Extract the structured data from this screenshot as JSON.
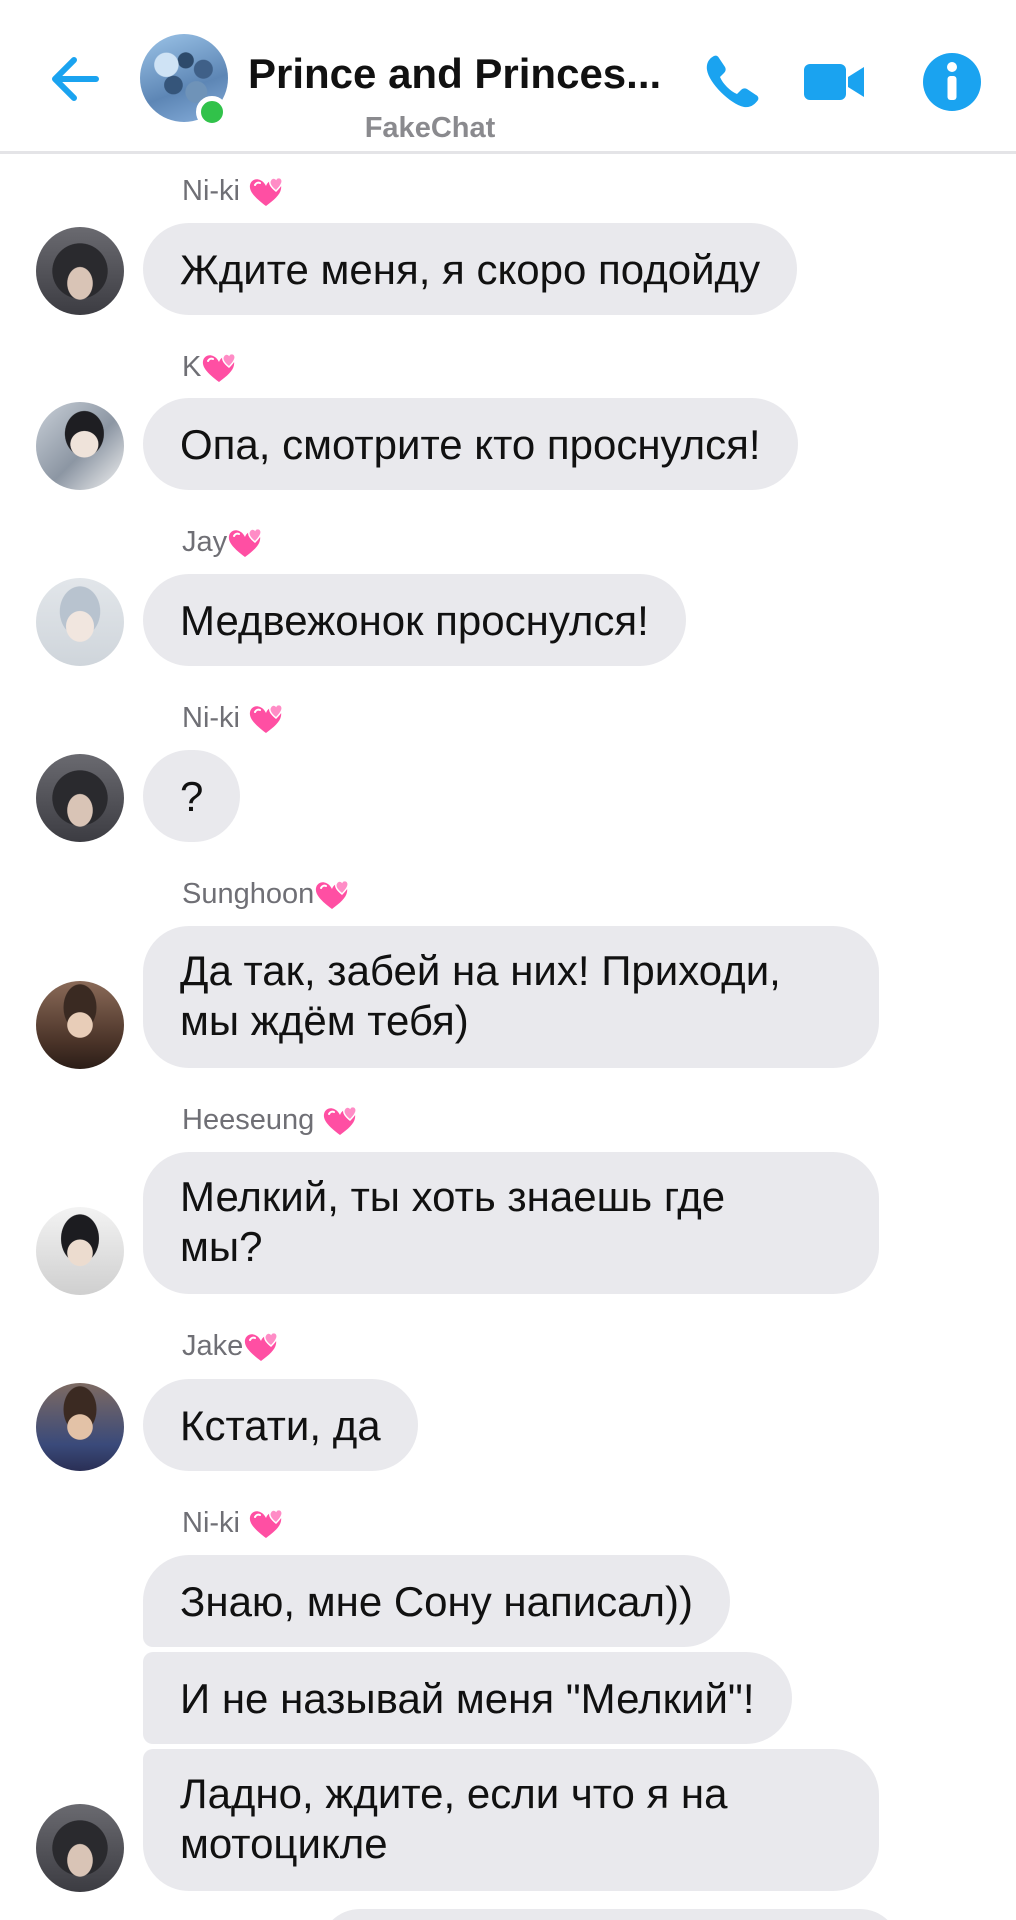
{
  "header": {
    "title": "Prince and Princes...",
    "subtitle": "FakeChat",
    "back_icon": "arrow-left-icon",
    "call_icon": "phone-icon",
    "video_icon": "video-camera-icon",
    "info_icon": "info-icon",
    "accent_color": "#1aa3f0",
    "online_color": "#31c24a"
  },
  "messages": [
    {
      "sender": "Ni-ki",
      "text": "Ждите меня, я скоро подойду"
    },
    {
      "sender": "K",
      "text": "Опа, смотрите кто проснулся!"
    },
    {
      "sender": "Jay",
      "text": "Медвежонок проснулся!"
    },
    {
      "sender": "Ni-ki",
      "text": "?"
    },
    {
      "sender": "Sunghoon",
      "line1": "Да так, забей на них! Приходи,",
      "line2": "мы ждём тебя)"
    },
    {
      "sender": "Heeseung",
      "line1": "Мелкий, ты хоть знаешь где",
      "line2": "мы?"
    },
    {
      "sender": "Jake",
      "text": "Кстати, да"
    },
    {
      "sender": "Ni-ki",
      "texts": [
        "Знаю, мне Сону написал))",
        "И не называй меня \"Мелкий\"!"
      ],
      "line1": "Ладно, ждите, если что я на",
      "line2": "мотоцикле"
    }
  ],
  "colors": {
    "bubble": "#e9e9ed",
    "sender_name": "#6f6f75",
    "heart": "#ff4fa3"
  }
}
